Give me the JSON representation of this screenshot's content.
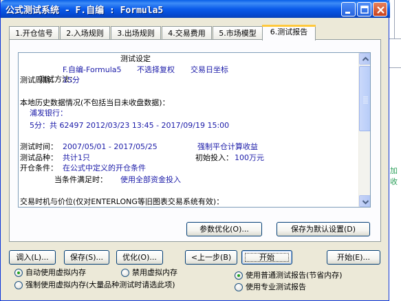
{
  "window": {
    "title": "公式测试系统 - F.自编 : Formula5"
  },
  "tabs": [
    {
      "label": "1.开仓信号"
    },
    {
      "label": "2.入场规则"
    },
    {
      "label": "3.出场规则"
    },
    {
      "label": "4.交易费用"
    },
    {
      "label": "5.市场模型"
    },
    {
      "label": "6.测试报告"
    }
  ],
  "report": {
    "heading": "测试设定",
    "method_label": "测试方法：",
    "method_formula": "F.自编-Formula5",
    "method_rights": "不选择复权",
    "method_axis": "交易日坐标",
    "period_label": "测试周期：",
    "period_value": "15分",
    "history_header": "本地历史数据情况(不包括当日未收盘数据)：",
    "history_stock": "浦发银行：",
    "history_range": "5分：共 62497 2012/03/23 13:45 - 2017/09/19 15:00",
    "time_label": "测试时间：",
    "time_value": "2007/05/01 - 2017/05/25",
    "force_close": "强制平仓计算收益",
    "variety_label": "测试品种：",
    "variety_value": "共计1只",
    "initial_label": "初始投入：",
    "initial_value": "100万元",
    "open_label": "开仓条件：",
    "open_value": "在公式中定义的开仓条件",
    "when_label": "当条件满足时：",
    "when_value": "使用全部资金投入",
    "timing_header": "交易时机与价位(仅对ENTERLONG等旧图表交易系统有效)："
  },
  "buttons": {
    "param_optimize": "参数优化(O)...",
    "save_default": "保存为默认设置(D)",
    "load": "调入(L)...",
    "save": "保存(S)...",
    "optimize": "优化(O)...",
    "prev": "上一步(B)",
    "start": "开始",
    "begin": "开始(E)..."
  },
  "options": {
    "auto_memory": "自动使用虚拟内存",
    "disable_memory": "禁用虚拟内存",
    "force_memory": "强制使用虚拟内存(大量品种测试时请选此项)",
    "normal_report": "使用普通测试报告(节省内存)",
    "pro_report": "使用专业测试报告",
    "selected_memory": "auto_memory",
    "selected_report": "normal_report"
  },
  "background": {
    "fragment": "加收"
  },
  "colors": {
    "title_bar": "#0a5fe8",
    "report_value_text": "#1a1aa8",
    "window_face": "#ece9d8",
    "active_tab_highlight": "#ffc83c"
  },
  "icons": [
    "minimize-icon",
    "maximize-icon",
    "close-icon",
    "scroll-up-icon",
    "scroll-down-icon",
    "previous-arrow-icon"
  ]
}
